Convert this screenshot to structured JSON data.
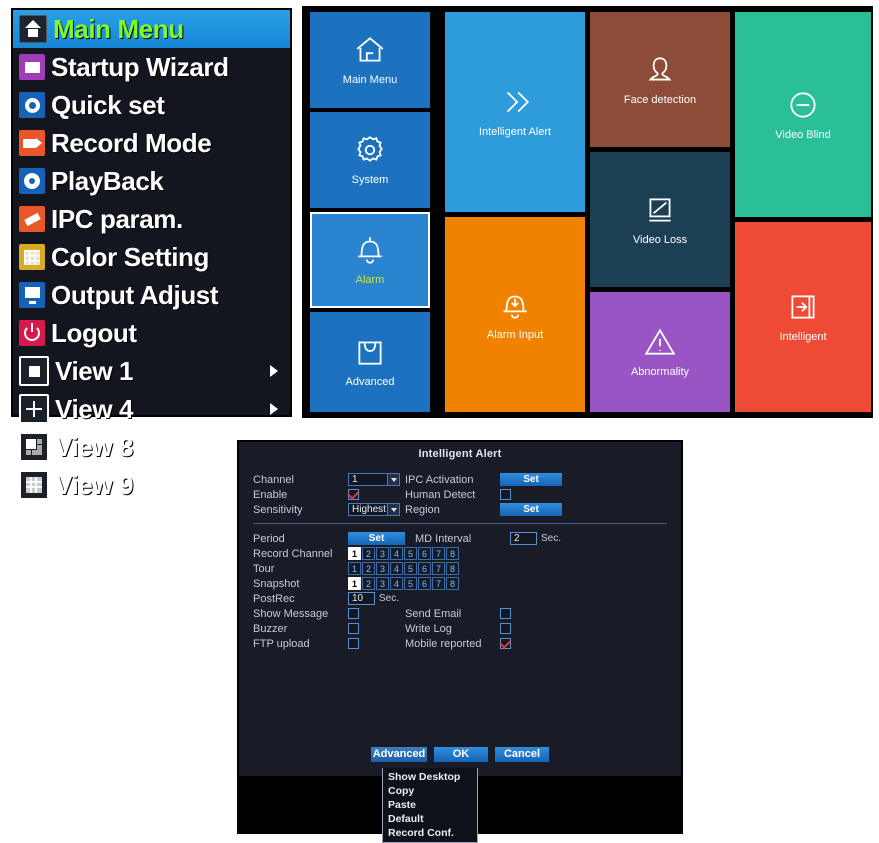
{
  "context_menu": {
    "name": "NVR right-click menu",
    "items": [
      {
        "label": "Main Menu",
        "icon": "home-icon",
        "selected": true,
        "submenu": false
      },
      {
        "label": "Startup Wizard",
        "icon": "wizard-icon",
        "selected": false,
        "submenu": false
      },
      {
        "label": "Quick set",
        "icon": "dome-camera-icon",
        "selected": false,
        "submenu": false
      },
      {
        "label": "Record Mode",
        "icon": "camcorder-icon",
        "selected": false,
        "submenu": false
      },
      {
        "label": "PlayBack",
        "icon": "playback-disc-icon",
        "selected": false,
        "submenu": false
      },
      {
        "label": "IPC param.",
        "icon": "bullet-camera-icon",
        "selected": false,
        "submenu": false
      },
      {
        "label": "Color Setting",
        "icon": "color-grid-icon",
        "selected": false,
        "submenu": false
      },
      {
        "label": "Output Adjust",
        "icon": "monitor-icon",
        "selected": false,
        "submenu": false
      },
      {
        "label": "Logout",
        "icon": "power-icon",
        "selected": false,
        "submenu": false
      },
      {
        "label": "View 1",
        "icon": "view1-grid-icon",
        "selected": false,
        "submenu": true
      },
      {
        "label": "View 4",
        "icon": "view4-grid-icon",
        "selected": false,
        "submenu": true
      },
      {
        "label": "View 8",
        "icon": "view8-grid-icon",
        "selected": false,
        "submenu": false
      },
      {
        "label": "View 9",
        "icon": "view9-grid-icon",
        "selected": false,
        "submenu": false
      }
    ]
  },
  "dashboard": {
    "nav": [
      {
        "label": "Main Menu",
        "icon": "home-icon",
        "active": false,
        "color": "#1c72bf"
      },
      {
        "label": "System",
        "icon": "gear-icon",
        "active": false,
        "color": "#1c72bf"
      },
      {
        "label": "Alarm",
        "icon": "bell-icon",
        "active": true,
        "color": "#2a84d0"
      },
      {
        "label": "Advanced",
        "icon": "toolbox-icon",
        "active": false,
        "color": "#1c72bf"
      }
    ],
    "tiles": [
      {
        "label": "Intelligent Alert",
        "icon": "double-chevron-right-icon",
        "color": "#2e9bdb"
      },
      {
        "label": "Alarm Input",
        "icon": "bell-down-arrow-icon",
        "color": "#f08200"
      },
      {
        "label": "Face detection",
        "icon": "face-icon",
        "color": "#8d4c38"
      },
      {
        "label": "Video Loss",
        "icon": "screen-slash-icon",
        "color": "#1b4054"
      },
      {
        "label": "Abnormality",
        "icon": "warning-triangle-icon",
        "color": "#9a55c4"
      },
      {
        "label": "Video Blind",
        "icon": "circle-minus-icon",
        "color": "#2abf96"
      },
      {
        "label": "Intelligent",
        "icon": "arrow-into-box-icon",
        "color": "#ef4a35"
      }
    ]
  },
  "dialog": {
    "title": "Intelligent Alert",
    "labels": {
      "channel": "Channel",
      "enable": "Enable",
      "sensitivity": "Sensitivity",
      "ipc_activation": "IPC Activation",
      "human_detect": "Human Detect",
      "region": "Region",
      "period": "Period",
      "md_interval": "MD Interval",
      "record_channel": "Record Channel",
      "tour": "Tour",
      "snapshot": "Snapshot",
      "postrec": "PostRec",
      "show_message": "Show Message",
      "send_email": "Send Email",
      "buzzer": "Buzzer",
      "write_log": "Write Log",
      "ftp_upload": "FTP upload",
      "mobile_reported": "Mobile reported",
      "sec": "Sec."
    },
    "values": {
      "channel": "1",
      "enable": true,
      "sensitivity": "Highest",
      "ipc_activation_btn": "Set",
      "human_detect": false,
      "region_btn": "Set",
      "period_btn": "Set",
      "md_interval": "2",
      "postrec": "10",
      "show_message": false,
      "send_email": false,
      "buzzer": false,
      "write_log": false,
      "ftp_upload": false,
      "mobile_reported": true
    },
    "channel_boxes": {
      "record_channel": [
        {
          "n": "1",
          "on": true
        },
        {
          "n": "2",
          "on": false
        },
        {
          "n": "3",
          "on": false
        },
        {
          "n": "4",
          "on": false
        },
        {
          "n": "5",
          "on": false
        },
        {
          "n": "6",
          "on": false
        },
        {
          "n": "7",
          "on": false
        },
        {
          "n": "8",
          "on": false
        }
      ],
      "tour": [
        {
          "n": "1",
          "on": false
        },
        {
          "n": "2",
          "on": false
        },
        {
          "n": "3",
          "on": false
        },
        {
          "n": "4",
          "on": false
        },
        {
          "n": "5",
          "on": false
        },
        {
          "n": "6",
          "on": false
        },
        {
          "n": "7",
          "on": false
        },
        {
          "n": "8",
          "on": false
        }
      ],
      "snapshot": [
        {
          "n": "1",
          "on": true
        },
        {
          "n": "2",
          "on": false
        },
        {
          "n": "3",
          "on": false
        },
        {
          "n": "4",
          "on": false
        },
        {
          "n": "5",
          "on": false
        },
        {
          "n": "6",
          "on": false
        },
        {
          "n": "7",
          "on": false
        },
        {
          "n": "8",
          "on": false
        }
      ]
    },
    "buttons": {
      "advanced": "Advanced",
      "ok": "OK",
      "cancel": "Cancel"
    },
    "advanced_menu": [
      "Show Desktop",
      "Copy",
      "Paste",
      "Default",
      "Record Conf."
    ]
  },
  "colors": {
    "accent_blue": "#2e9bdb",
    "nav_blue": "#1c72bf",
    "selected_text": "#c8e83a",
    "menu_highlight": "#1587d6",
    "check_red": "#e03b3b"
  }
}
